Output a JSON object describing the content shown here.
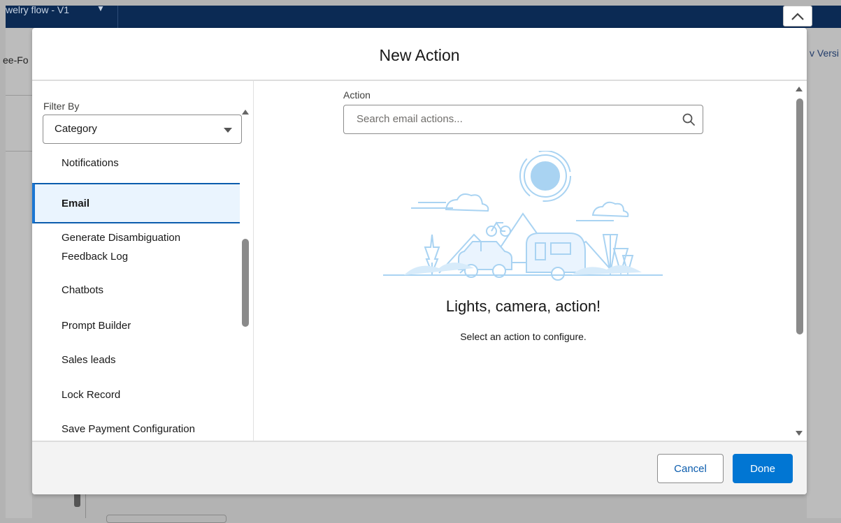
{
  "background": {
    "flow_name": "welry flow - V1",
    "left_tab_text": "ee-Fo",
    "right_tab_text": "v Versi"
  },
  "modal": {
    "title": "New Action",
    "filter": {
      "label": "Filter By",
      "selected": "Category"
    },
    "categories": [
      "Notifications",
      "Email",
      "Generate Disambiguation Feedback Log",
      "Chatbots",
      "Prompt Builder",
      "Sales leads",
      "Lock Record",
      "Save Payment Configuration"
    ],
    "selected_category": "Email",
    "action": {
      "label": "Action",
      "placeholder": "Search email actions...",
      "value": ""
    },
    "empty_state": {
      "title": "Lights, camera, action!",
      "subtitle": "Select an action to configure."
    },
    "footer": {
      "cancel_label": "Cancel",
      "done_label": "Done"
    }
  },
  "colors": {
    "brand_blue": "#0176d3",
    "selected_bg": "#eaf4fe",
    "header_navy": "#0b2a54",
    "illustration_blue": "#a9d3f2"
  }
}
